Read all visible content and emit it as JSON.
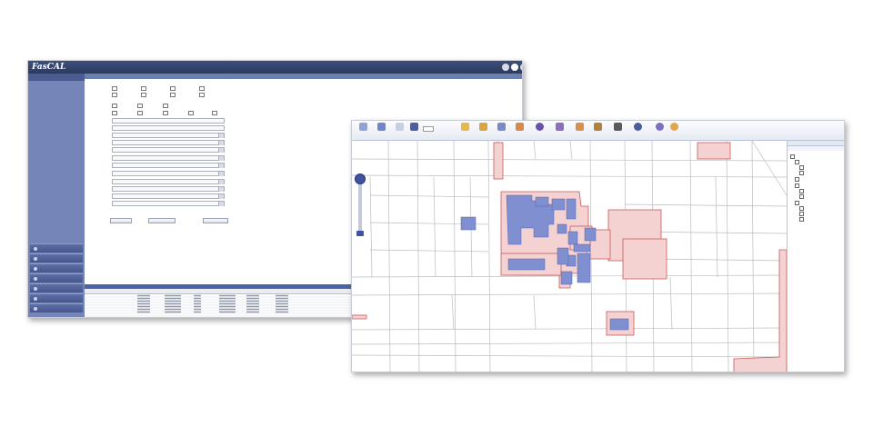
{
  "app1": {
    "logo": "FasCAL",
    "logo_sub": "",
    "window_title": "",
    "user_label": "",
    "logout_label": "",
    "menu_label": "",
    "sidebar": {
      "header": "",
      "links": [
        "",
        "",
        "",
        ""
      ],
      "buttons": [
        "",
        "",
        "",
        "",
        "",
        "",
        ""
      ]
    },
    "form": {
      "labels": [
        "",
        "",
        "",
        "",
        "",
        "",
        "",
        "",
        "",
        "",
        "",
        "",
        "",
        "",
        "",
        ""
      ],
      "buttons": [
        "",
        "",
        ""
      ]
    },
    "results": {
      "bar_label": "",
      "headers": [
        "",
        "",
        "",
        "",
        "",
        "",
        "",
        "",
        "",
        "",
        ""
      ],
      "row_count": 9,
      "footer_button": ""
    }
  },
  "app2": {
    "tools": [
      "",
      "",
      "",
      "",
      "",
      "",
      "",
      "",
      "",
      "",
      "",
      "",
      "",
      "",
      "",
      "",
      "",
      ""
    ],
    "scale_value": "",
    "map_label": "",
    "scale_text": "",
    "corner_text": "",
    "layers": {
      "header": "",
      "tab": "",
      "items": [
        "",
        "",
        "",
        "",
        "",
        "",
        "",
        "",
        "",
        "",
        "",
        ""
      ]
    }
  },
  "colors": {
    "titlebar": "#2c3a5f",
    "sidebar": "#7585b8",
    "results_bar": "#4b63a8",
    "parcel_fill": "#f4d2d2",
    "parcel_stroke": "#c85a5a",
    "building_fill": "#7f8fd0",
    "road_line": "#b8b8b8"
  }
}
